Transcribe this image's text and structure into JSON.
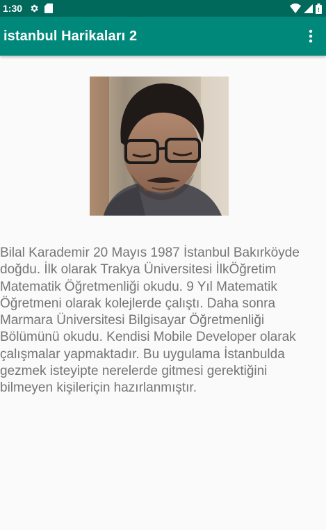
{
  "status_bar": {
    "time": "1:30",
    "icons": [
      "gear-icon",
      "sd-card-icon",
      "wifi-icon",
      "signal-icon",
      "battery-icon"
    ]
  },
  "app_bar": {
    "title": "istanbul Harikaları 2",
    "overflow_icon": "more-vert-icon",
    "color": "#00897b",
    "status_color": "#00695c"
  },
  "profile": {
    "photo": "portrait-photo"
  },
  "bio": {
    "text": "Bilal Karademir 20 Mayıs 1987 İstanbul Bakırköyde doğdu. İlk olarak Trakya Üniversitesi İlkÖğretim Matematik Öğretmenliği okudu. 9 Yıl Matematik Öğretmeni olarak kolejlerde çalıştı. Daha sonra Marmara Üniversitesi Bilgisayar Öğretmenliği Bölümünü okudu. Kendisi Mobile Developer olarak çalışmalar yapmaktadır. Bu uygulama İstanbulda gezmek isteyipte nerelerde gitmesi gerektiğini bilmeyen kişileriçin hazırlanmıştır."
  }
}
